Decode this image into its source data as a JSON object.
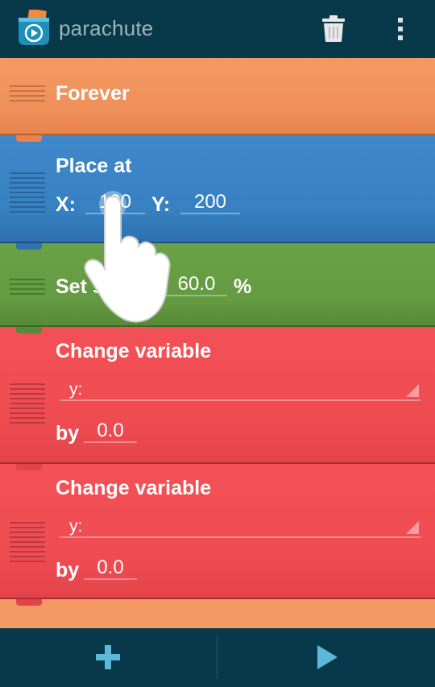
{
  "app": {
    "title": "parachute"
  },
  "bricks": {
    "forever": {
      "label": "Forever"
    },
    "place_at": {
      "label": "Place at",
      "x_label": "X:",
      "x_value": "100",
      "y_label": "Y:",
      "y_value": "200"
    },
    "set_size": {
      "label": "Set s",
      "value": "60.0",
      "unit": "%"
    },
    "change_variable_1": {
      "label": "Change variable",
      "variable": "y:",
      "by_label": "by",
      "by_value": "0.0"
    },
    "change_variable_2": {
      "label": "Change variable",
      "variable": "y:",
      "by_label": "by",
      "by_value": "0.0"
    }
  },
  "icons": {
    "app": "app-logo-icon",
    "delete": "trash-icon",
    "menu": "overflow-menu-icon",
    "add": "plus-icon",
    "play": "play-icon",
    "gesture": "tap-hand-icon"
  },
  "colors": {
    "actionbar": "#07394a",
    "forever": "#f39a64",
    "place_at": "#3f88c9",
    "set_size": "#6aa147",
    "change_variable": "#f25156",
    "accent_icon": "#5bb8d8"
  }
}
